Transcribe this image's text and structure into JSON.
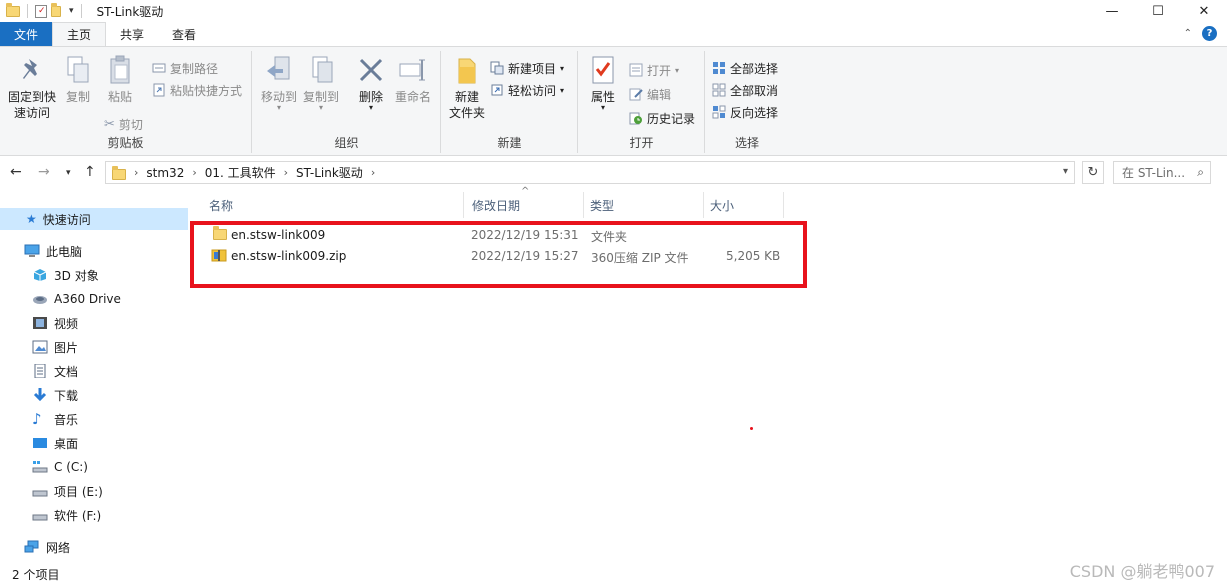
{
  "window": {
    "title": "ST-Link驱动",
    "controls": [
      "—",
      "☐",
      "✕"
    ]
  },
  "ribbon_tabs": [
    "文件",
    "主页",
    "共享",
    "查看"
  ],
  "ribbon": {
    "clipboard": {
      "pin_label_1": "固定到快",
      "pin_label_2": "速访问",
      "copy": "复制",
      "paste": "粘贴",
      "copy_path": "复制路径",
      "paste_shortcut": "粘贴快捷方式",
      "cut": "剪切",
      "group": "剪贴板"
    },
    "organize": {
      "move_to": "移动到",
      "copy_to": "复制到",
      "delete": "删除",
      "rename": "重命名",
      "group": "组织"
    },
    "new": {
      "new_folder_1": "新建",
      "new_folder_2": "文件夹",
      "new_item": "新建项目",
      "easy_access": "轻松访问",
      "group": "新建"
    },
    "open": {
      "properties": "属性",
      "open": "打开",
      "edit": "编辑",
      "history": "历史记录",
      "group": "打开"
    },
    "select": {
      "select_all": "全部选择",
      "select_none": "全部取消",
      "invert": "反向选择",
      "group": "选择"
    }
  },
  "address": {
    "crumbs": [
      "stm32",
      "01. 工具软件",
      "ST-Link驱动"
    ],
    "search_placeholder": "在 ST-Lin..."
  },
  "nav_pane": {
    "quick_access": "快速访问",
    "this_pc": "此电脑",
    "items": [
      "3D 对象",
      "A360 Drive",
      "视频",
      "图片",
      "文档",
      "下载",
      "音乐",
      "桌面",
      "C (C:)",
      "项目 (E:)",
      "软件 (F:)"
    ],
    "network": "网络"
  },
  "columns": [
    "名称",
    "修改日期",
    "类型",
    "大小"
  ],
  "files": [
    {
      "name": "en.stsw-link009",
      "date": "2022/12/19 15:31",
      "type": "文件夹",
      "size": ""
    },
    {
      "name": "en.stsw-link009.zip",
      "date": "2022/12/19 15:27",
      "type": "360压缩 ZIP 文件",
      "size": "5,205 KB"
    }
  ],
  "status": "2 个项目",
  "watermark": "CSDN @躺老鸭007",
  "colors": {
    "file_tab": "#1a6fc2",
    "highlight_box": "#e8121c",
    "selected_nav": "#cce8ff"
  }
}
